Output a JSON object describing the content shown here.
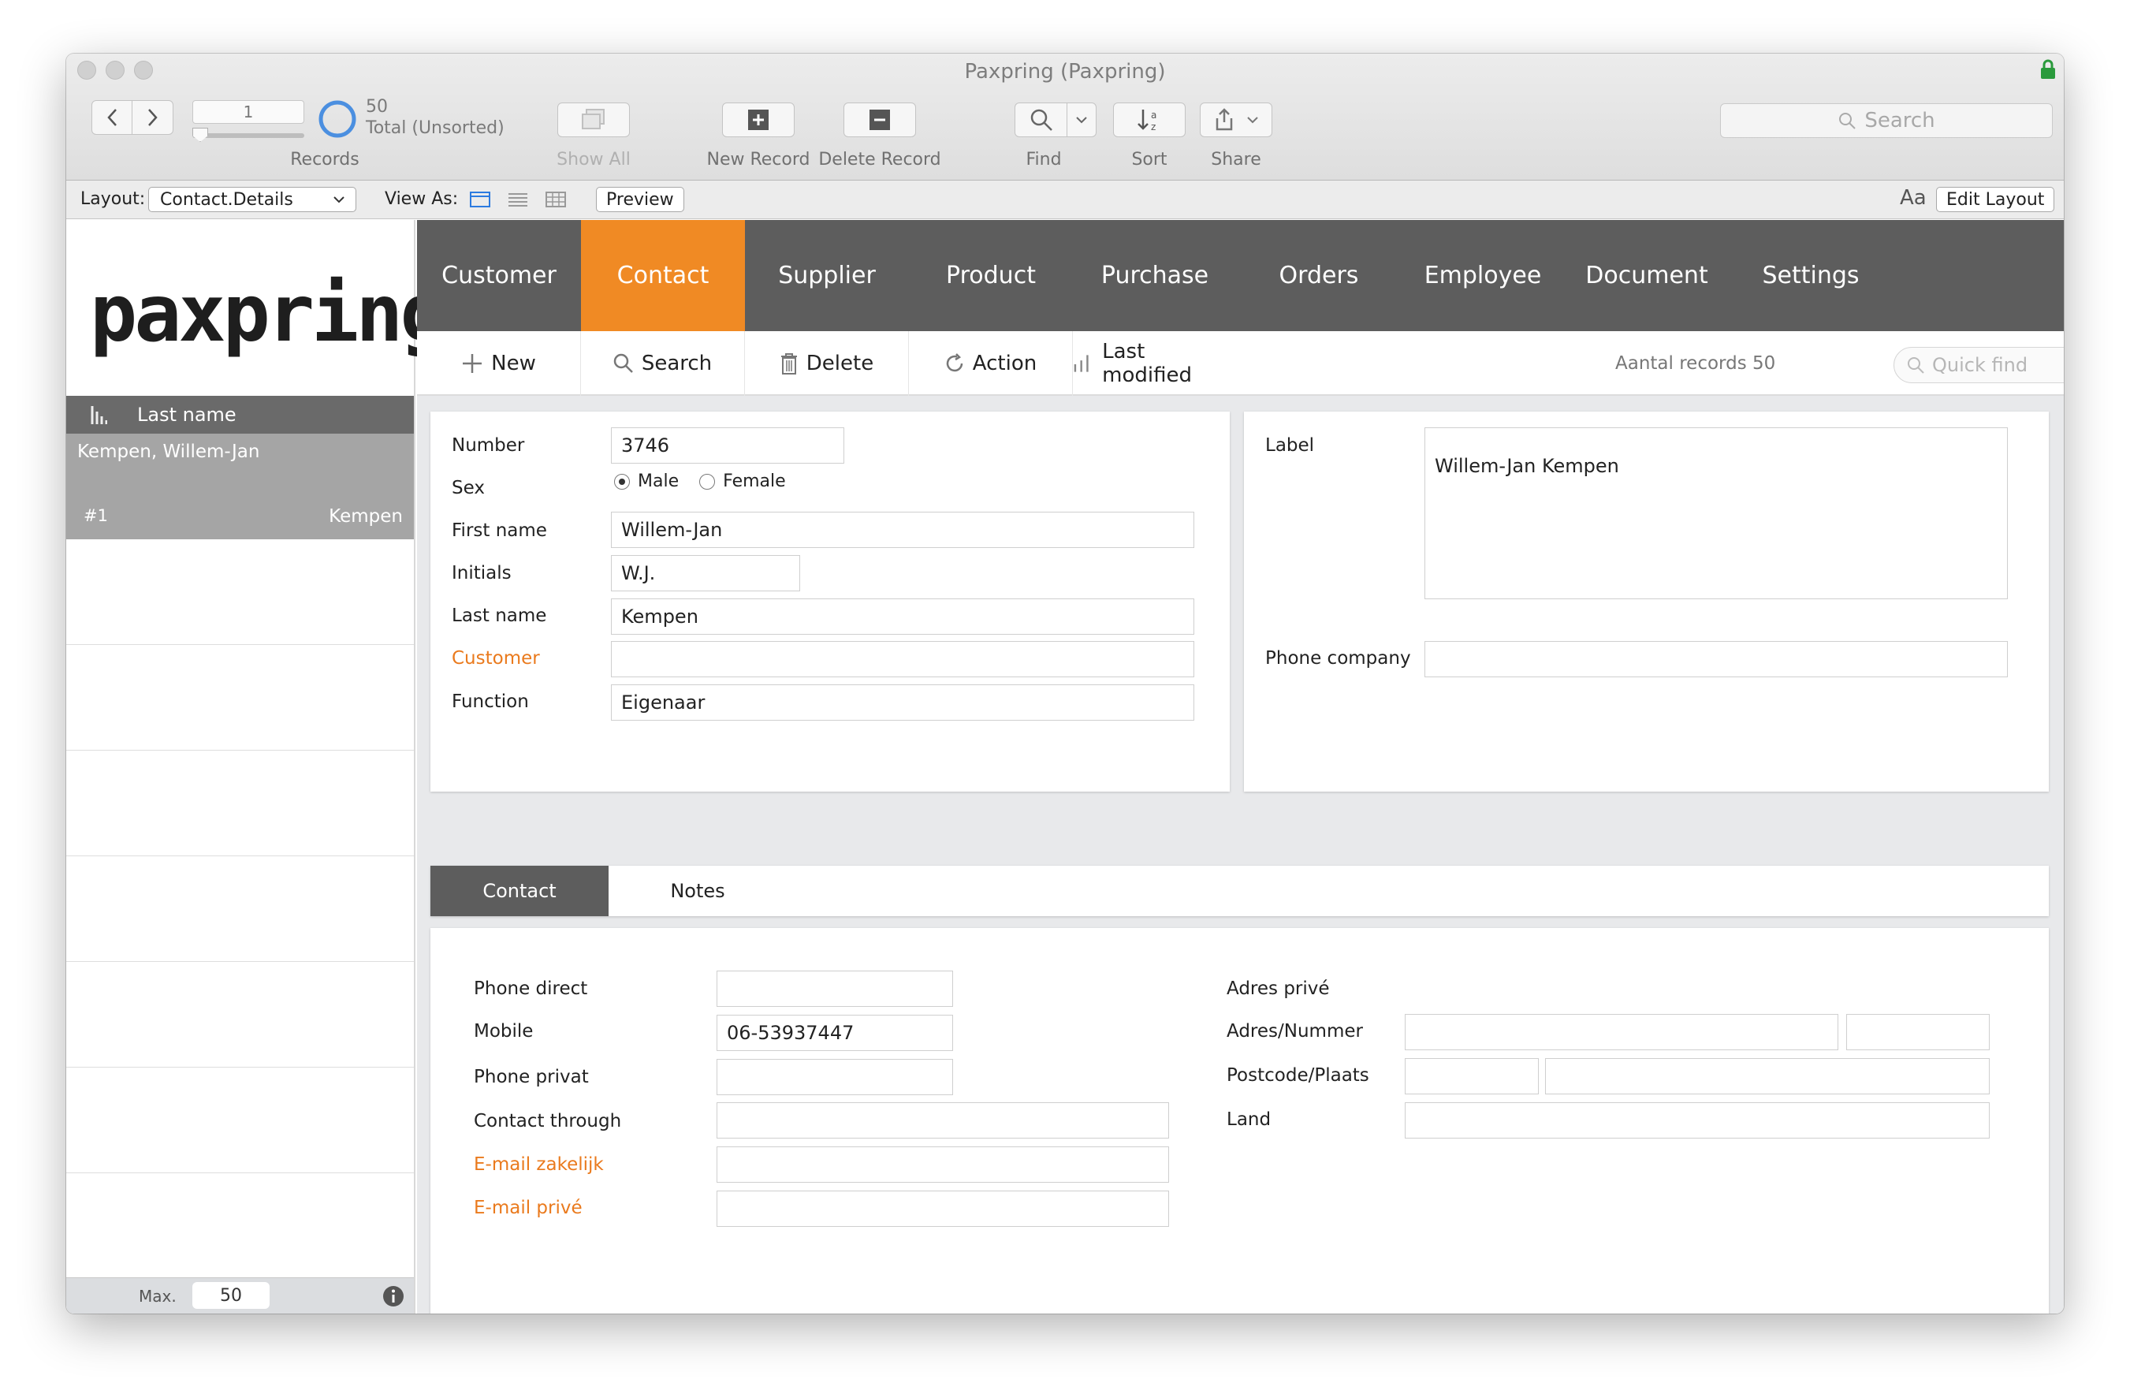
{
  "window": {
    "title": "Paxpring (Paxpring)"
  },
  "toolbar": {
    "record_number": "1",
    "record_count": "50",
    "record_status": "Total (Unsorted)",
    "records_label": "Records",
    "show_all_label": "Show All",
    "new_record_label": "New Record",
    "delete_record_label": "Delete Record",
    "find_label": "Find",
    "sort_label": "Sort",
    "share_label": "Share",
    "search_placeholder": "Search"
  },
  "layout_bar": {
    "layout_label": "Layout:",
    "layout_value": "Contact.Details",
    "view_as_label": "View As:",
    "preview_label": "Preview",
    "edit_layout_label": "Edit Layout",
    "text_size_glyph": "Aa"
  },
  "sidebar": {
    "logo": "paxpring",
    "logo_mark": "®",
    "list_header": "Last name",
    "selected_record": {
      "name": "Kempen, Willem-Jan",
      "index": "#1",
      "last_name": "Kempen"
    },
    "footer_label": "Max.",
    "footer_value": "50"
  },
  "nav": {
    "items": [
      "Customer",
      "Contact",
      "Supplier",
      "Product",
      "Purchase",
      "Orders",
      "Employee",
      "Document",
      "Settings"
    ],
    "active": "Contact"
  },
  "subtoolbar": {
    "new_label": "New",
    "search_label": "Search",
    "delete_label": "Delete",
    "action_label": "Action",
    "last_modified_label": "Last modified",
    "records_count_text": "Aantal records 50",
    "quick_find_placeholder": "Quick find"
  },
  "contact": {
    "number_label": "Number",
    "number": "3746",
    "sex_label": "Sex",
    "sex_male": "Male",
    "sex_female": "Female",
    "sex_selected": "Male",
    "first_name_label": "First name",
    "first_name": "Willem-Jan",
    "initials_label": "Initials",
    "initials": "W.J.",
    "last_name_label": "Last name",
    "last_name": "Kempen",
    "customer_label": "Customer",
    "customer": "",
    "function_label": "Function",
    "function": "Eigenaar",
    "label_label": "Label",
    "label": "Willem-Jan Kempen",
    "phone_company_label": "Phone company",
    "phone_company": ""
  },
  "tabs": {
    "items": [
      "Contact",
      "Notes"
    ],
    "active": "Contact"
  },
  "contact_tab": {
    "phone_direct_label": "Phone direct",
    "phone_direct": "",
    "mobile_label": "Mobile",
    "mobile": "06-53937447",
    "phone_privat_label": "Phone privat",
    "phone_privat": "",
    "contact_through_label": "Contact through",
    "contact_through": "",
    "email_business_label": "E-mail zakelijk",
    "email_business": "",
    "email_private_label": "E-mail privé",
    "email_private": "",
    "address_private_label": "Adres privé",
    "address_number_label": "Adres/Nummer",
    "postcode_city_label": "Postcode/Plaats",
    "country_label": "Land"
  },
  "colors": {
    "accent": "#f08a24",
    "nav_bg": "#5d5d5d",
    "link_label": "#ea7a1d"
  }
}
